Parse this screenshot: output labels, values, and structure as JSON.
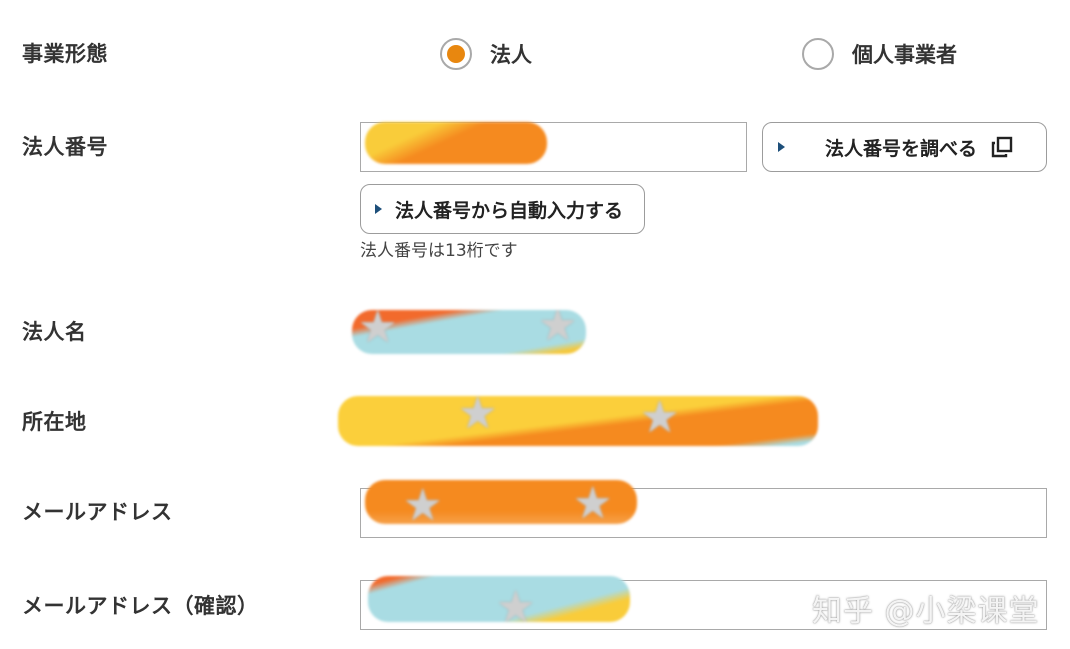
{
  "form": {
    "business_type": {
      "label": "事業形態",
      "options": [
        {
          "label": "法人",
          "checked": true
        },
        {
          "label": "個人事業者",
          "checked": false
        }
      ]
    },
    "corp_number": {
      "label": "法人番号",
      "lookup_button": "法人番号を調べる",
      "autofill_button": "法人番号から自動入力する",
      "hint": "法人番号は13桁です"
    },
    "corp_name": {
      "label": "法人名"
    },
    "address": {
      "label": "所在地"
    },
    "email": {
      "label": "メールアドレス"
    },
    "email_confirm": {
      "label": "メールアドレス（確認）"
    }
  },
  "colors": {
    "radio_selected": "#e8870f",
    "border": "#a9a9a9",
    "button_arrow": "#1d4f7a"
  },
  "watermark": "知乎 @小梁课堂"
}
